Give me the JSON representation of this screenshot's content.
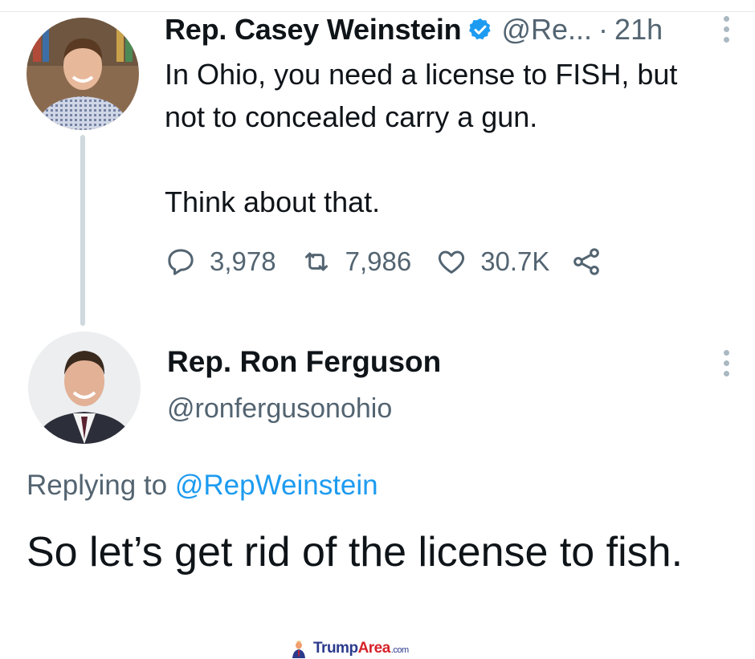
{
  "tweet1": {
    "author_name": "Rep. Casey Weinstein",
    "handle": "@Re...",
    "separator": "·",
    "time": "21h",
    "verified_icon": "verified-badge-icon",
    "text_lines": [
      "In Ohio, you need a license to FISH, but",
      "not to concealed carry a gun."
    ],
    "text_line_3": "Think about that.",
    "replies": "3,978",
    "retweets": "7,986",
    "likes": "30.7K"
  },
  "tweet2": {
    "author_name": "Rep. Ron Ferguson",
    "handle": "@ronfergusonohio",
    "replying_prefix": "Replying to",
    "replying_to": "@RepWeinstein",
    "text": "So let’s get rid of the license to fish."
  },
  "watermark": {
    "brand_main": "Trump",
    "brand_accent": "Area",
    "brand_domain": ".com"
  },
  "colors": {
    "verified": "#1d9bf0",
    "mention": "#1d9bf0",
    "muted": "#536471",
    "text": "#0f1419"
  }
}
